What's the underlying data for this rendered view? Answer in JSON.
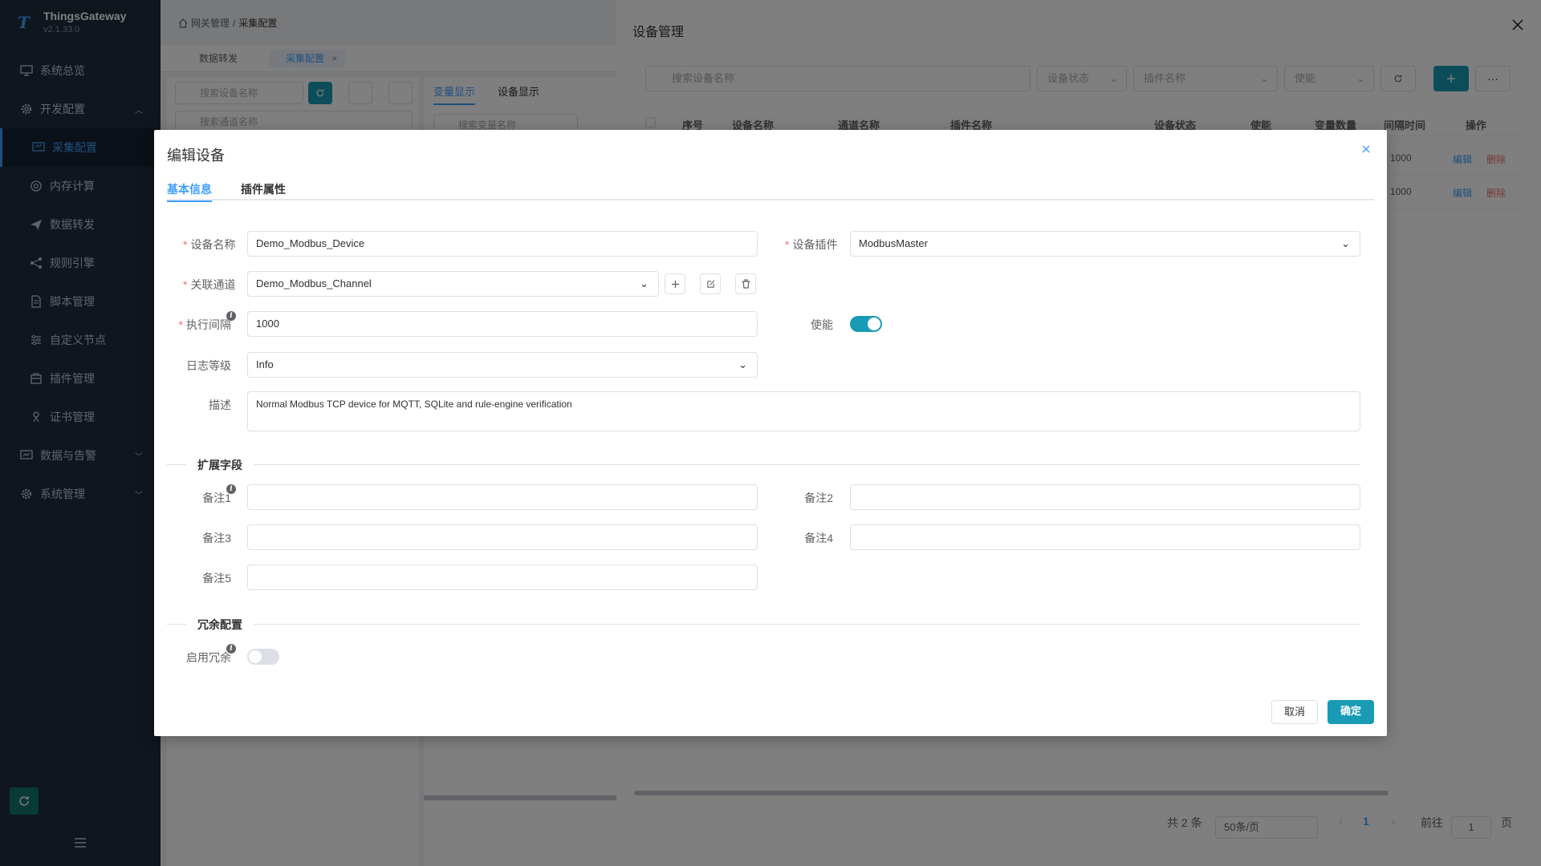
{
  "app": {
    "name": "ThingsGateway",
    "version": "v2.1.33.0"
  },
  "sidebar": {
    "items": [
      {
        "label": "系统总览",
        "level": 1,
        "icon": "monitor-icon"
      },
      {
        "label": "开发配置",
        "level": 1,
        "icon": "gear-icon",
        "expanded": true
      },
      {
        "label": "采集配置",
        "level": 2,
        "icon": "collect-icon",
        "active": true
      },
      {
        "label": "内存计算",
        "level": 2,
        "icon": "compute-icon"
      },
      {
        "label": "数据转发",
        "level": 2,
        "icon": "send-icon"
      },
      {
        "label": "规则引擎",
        "level": 2,
        "icon": "share-icon"
      },
      {
        "label": "脚本管理",
        "level": 2,
        "icon": "script-icon"
      },
      {
        "label": "自定义节点",
        "level": 2,
        "icon": "sliders-icon"
      },
      {
        "label": "插件管理",
        "level": 2,
        "icon": "plugin-icon"
      },
      {
        "label": "证书管理",
        "level": 2,
        "icon": "certificate-icon"
      },
      {
        "label": "数据与告警",
        "level": 1,
        "icon": "alarm-icon"
      },
      {
        "label": "系统管理",
        "level": 1,
        "icon": "settings-icon"
      }
    ]
  },
  "breadcrumb": {
    "parent": "网关管理",
    "sep": "/",
    "current": "采集配置"
  },
  "page_tabs": [
    {
      "label": "数据转发"
    },
    {
      "label": "采集配置",
      "active": true
    }
  ],
  "left_panel": {
    "search_device_placeholder": "搜索设备名称",
    "search_channel_placeholder": "搜索通道名称"
  },
  "center_panel": {
    "tabs": [
      "变量显示",
      "设备显示"
    ],
    "search_placeholder": "搜索变量名称"
  },
  "drawer": {
    "title": "设备管理",
    "search_placeholder": "搜索设备名称",
    "filters": {
      "status": "设备状态",
      "plugin": "插件名称",
      "enable": "使能"
    },
    "columns": [
      "序号",
      "设备名称",
      "通道名称",
      "插件名称",
      "设备状态",
      "使能",
      "变量数量",
      "间隔时间",
      "操作"
    ],
    "rows": [
      {
        "interval": "1000",
        "edit": "编辑",
        "delete": "删除"
      },
      {
        "interval": "1000",
        "edit": "编辑",
        "delete": "删除"
      }
    ],
    "pager": {
      "total": "共 2 条",
      "page_size": "50条/页",
      "current_page": "1",
      "goto_label": "前往",
      "goto_value": "1",
      "page_suffix": "页"
    }
  },
  "dialog": {
    "title": "编辑设备",
    "tabs": [
      {
        "label": "基本信息",
        "active": true
      },
      {
        "label": "插件属性"
      }
    ],
    "fields": {
      "device_name": {
        "label": "设备名称",
        "value": "Demo_Modbus_Device",
        "required": true
      },
      "device_plugin": {
        "label": "设备插件",
        "value": "ModbusMaster",
        "required": true
      },
      "channel": {
        "label": "关联通道",
        "value": "Demo_Modbus_Channel",
        "required": true
      },
      "interval": {
        "label": "执行间隔",
        "value": "1000",
        "required": true
      },
      "enable": {
        "label": "使能",
        "on": true
      },
      "log_level": {
        "label": "日志等级",
        "value": "Info"
      },
      "description": {
        "label": "描述",
        "value": "Normal Modbus TCP device for MQTT, SQLite and rule-engine verification"
      }
    },
    "ext_section": {
      "title": "扩展字段",
      "remark1": {
        "label": "备注1",
        "value": ""
      },
      "remark2": {
        "label": "备注2",
        "value": ""
      },
      "remark3": {
        "label": "备注3",
        "value": ""
      },
      "remark4": {
        "label": "备注4",
        "value": ""
      },
      "remark5": {
        "label": "备注5",
        "value": ""
      }
    },
    "redundancy_section": {
      "title": "冗余配置",
      "enable_label": "启用冗余",
      "on": false
    },
    "buttons": {
      "cancel": "取消",
      "confirm": "确定"
    }
  },
  "colors": {
    "primary": "#409eff",
    "teal": "#1a9bb5",
    "sidebar_bg": "#1f2d3d",
    "danger": "#f56c6c"
  }
}
